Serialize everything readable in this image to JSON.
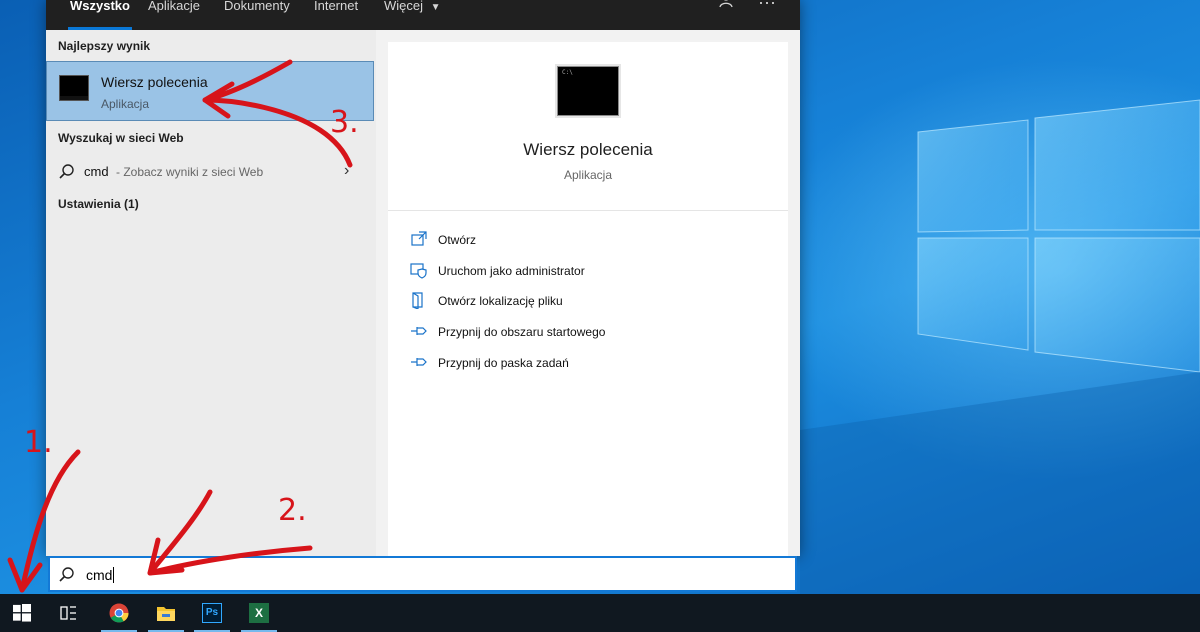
{
  "tabs": [
    "Wszystko",
    "Aplikacje",
    "Dokumenty",
    "Internet",
    "Więcej"
  ],
  "icons": {
    "feedback": "feedback-person-icon",
    "more": "ellipsis-icon"
  },
  "left": {
    "best_header": "Najlepszy wynik",
    "best_title": "Wiersz polecenia",
    "best_sub": "Aplikacja",
    "web_header": "Wyszukaj w sieci Web",
    "web_query": "cmd",
    "web_hint": "- Zobacz wyniki z sieci Web",
    "settings_header": "Ustawienia (1)"
  },
  "preview": {
    "title": "Wiersz polecenia",
    "subtitle": "Aplikacja",
    "actions": [
      "Otwórz",
      "Uruchom jako administrator",
      "Otwórz lokalizację pliku",
      "Przypnij do obszaru startowego",
      "Przypnij do paska zadań"
    ]
  },
  "search": {
    "value": "cmd"
  },
  "taskbar": [
    "start",
    "task-view",
    "chrome",
    "file-explorer",
    "photoshop",
    "excel"
  ],
  "taskbar_labels": {
    "photoshop": "Ps",
    "excel": "X"
  },
  "annotations": [
    "1.",
    "2.",
    "3."
  ],
  "colors": {
    "accent": "#0a78d7",
    "selection": "#9ac3e6",
    "annotation": "#d7141a"
  }
}
